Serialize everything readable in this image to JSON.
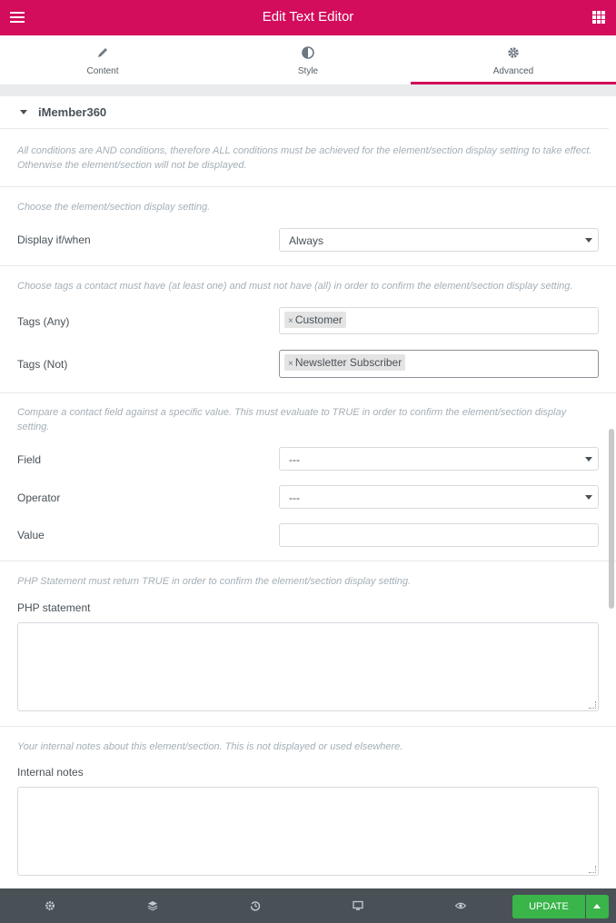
{
  "header": {
    "title": "Edit Text Editor",
    "menu_icon": "hamburger-icon",
    "apps_icon": "grid-icon"
  },
  "tabs": [
    {
      "label": "Content",
      "icon": "pencil-icon",
      "active": false
    },
    {
      "label": "Style",
      "icon": "half-circle-icon",
      "active": false
    },
    {
      "label": "Advanced",
      "icon": "gear-icon",
      "active": true
    }
  ],
  "section": {
    "title": "iMember360"
  },
  "notes": {
    "and_conditions": "All conditions are AND conditions, therefore ALL conditions must be achieved for the element/section display setting to take effect. Otherwise the element/section will not be displayed.",
    "choose_display": "Choose the element/section display setting.",
    "choose_tags": "Choose tags a contact must have (at least one) and must not have (all) in order to confirm the element/section display setting.",
    "compare_field": "Compare a contact field against a specific value. This must evaluate to TRUE in order to confirm the element/section display setting.",
    "php_note": "PHP Statement must return TRUE in order to confirm the element/section display setting.",
    "internal_note": "Your internal notes about this element/section. This is not displayed or used elsewhere."
  },
  "fields": {
    "display_label": "Display if/when",
    "display_value": "Always",
    "tags_any_label": "Tags (Any)",
    "tags_any_value": "Customer",
    "tags_not_label": "Tags (Not)",
    "tags_not_value": "Newsletter Subscriber",
    "field_label": "Field",
    "field_value": "---",
    "operator_label": "Operator",
    "operator_value": "---",
    "value_label": "Value",
    "value_value": "",
    "php_label": "PHP statement",
    "php_value": "",
    "internal_label": "Internal notes",
    "internal_value": ""
  },
  "footer": {
    "update_label": "UPDATE",
    "icons": [
      "settings-icon",
      "layers-icon",
      "history-icon",
      "responsive-icon",
      "preview-icon"
    ]
  },
  "colors": {
    "brand": "#d30c5c",
    "update": "#39b54a",
    "footer_bg": "#495157"
  }
}
